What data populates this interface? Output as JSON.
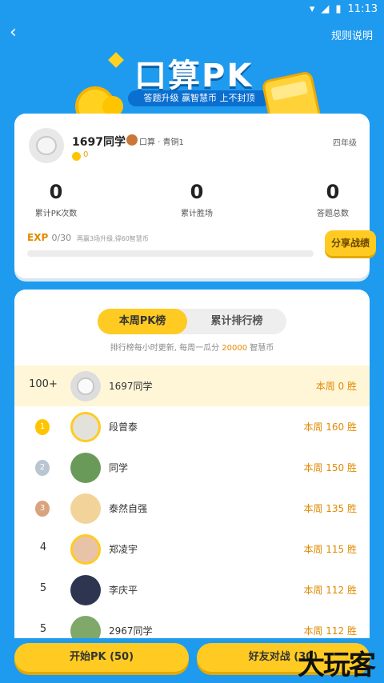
{
  "status": {
    "time": "11:13"
  },
  "nav": {
    "back_icon": "chevron-left-icon",
    "rules_label": "规则说明"
  },
  "hero": {
    "title": "口算PK",
    "subtitle": "答题升级 赢智慧币 上不封顶"
  },
  "profile": {
    "name": "1697同学",
    "rank": "口算 · 青铜1",
    "coins": "0",
    "grade": "四年级",
    "stats": [
      {
        "value": "0",
        "label": "累计PK次数"
      },
      {
        "value": "0",
        "label": "累计胜场"
      },
      {
        "value": "0",
        "label": "答题总数"
      }
    ],
    "exp_label": "EXP",
    "exp_value": "0/30",
    "exp_tip": "再赢3场升级,得60智慧币",
    "exp_progress": 0,
    "share_label": "分享战绩"
  },
  "leaderboard": {
    "tabs": [
      "本周PK榜",
      "累计排行榜"
    ],
    "active_tab": 0,
    "note_prefix": "排行榜每小时更新, 每周一瓜分",
    "note_amount": "20000",
    "note_suffix": "智慧币",
    "rows": [
      {
        "rank": "100+",
        "name": "1697同学",
        "week": "本周 0 胜",
        "me": true
      },
      {
        "rank": "1",
        "name": "段曾泰",
        "week": "本周 160 胜"
      },
      {
        "rank": "2",
        "name": "同学",
        "week": "本周 150 胜"
      },
      {
        "rank": "3",
        "name": "泰然自强",
        "week": "本周 135 胜"
      },
      {
        "rank": "4",
        "name": "郑凌宇",
        "week": "本周 115 胜"
      },
      {
        "rank": "5",
        "name": "李庆平",
        "week": "本周 112 胜"
      },
      {
        "rank": "5",
        "name": "2967同学",
        "week": "本周 112 胜"
      }
    ]
  },
  "actions": {
    "start_pk": "开始PK (50)",
    "friend_pk": "好友对战 (30)"
  },
  "watermark": "大玩客",
  "colors": {
    "bg": "#1e9bef",
    "accent": "#ffcb22",
    "highlight": "#e08a00"
  }
}
